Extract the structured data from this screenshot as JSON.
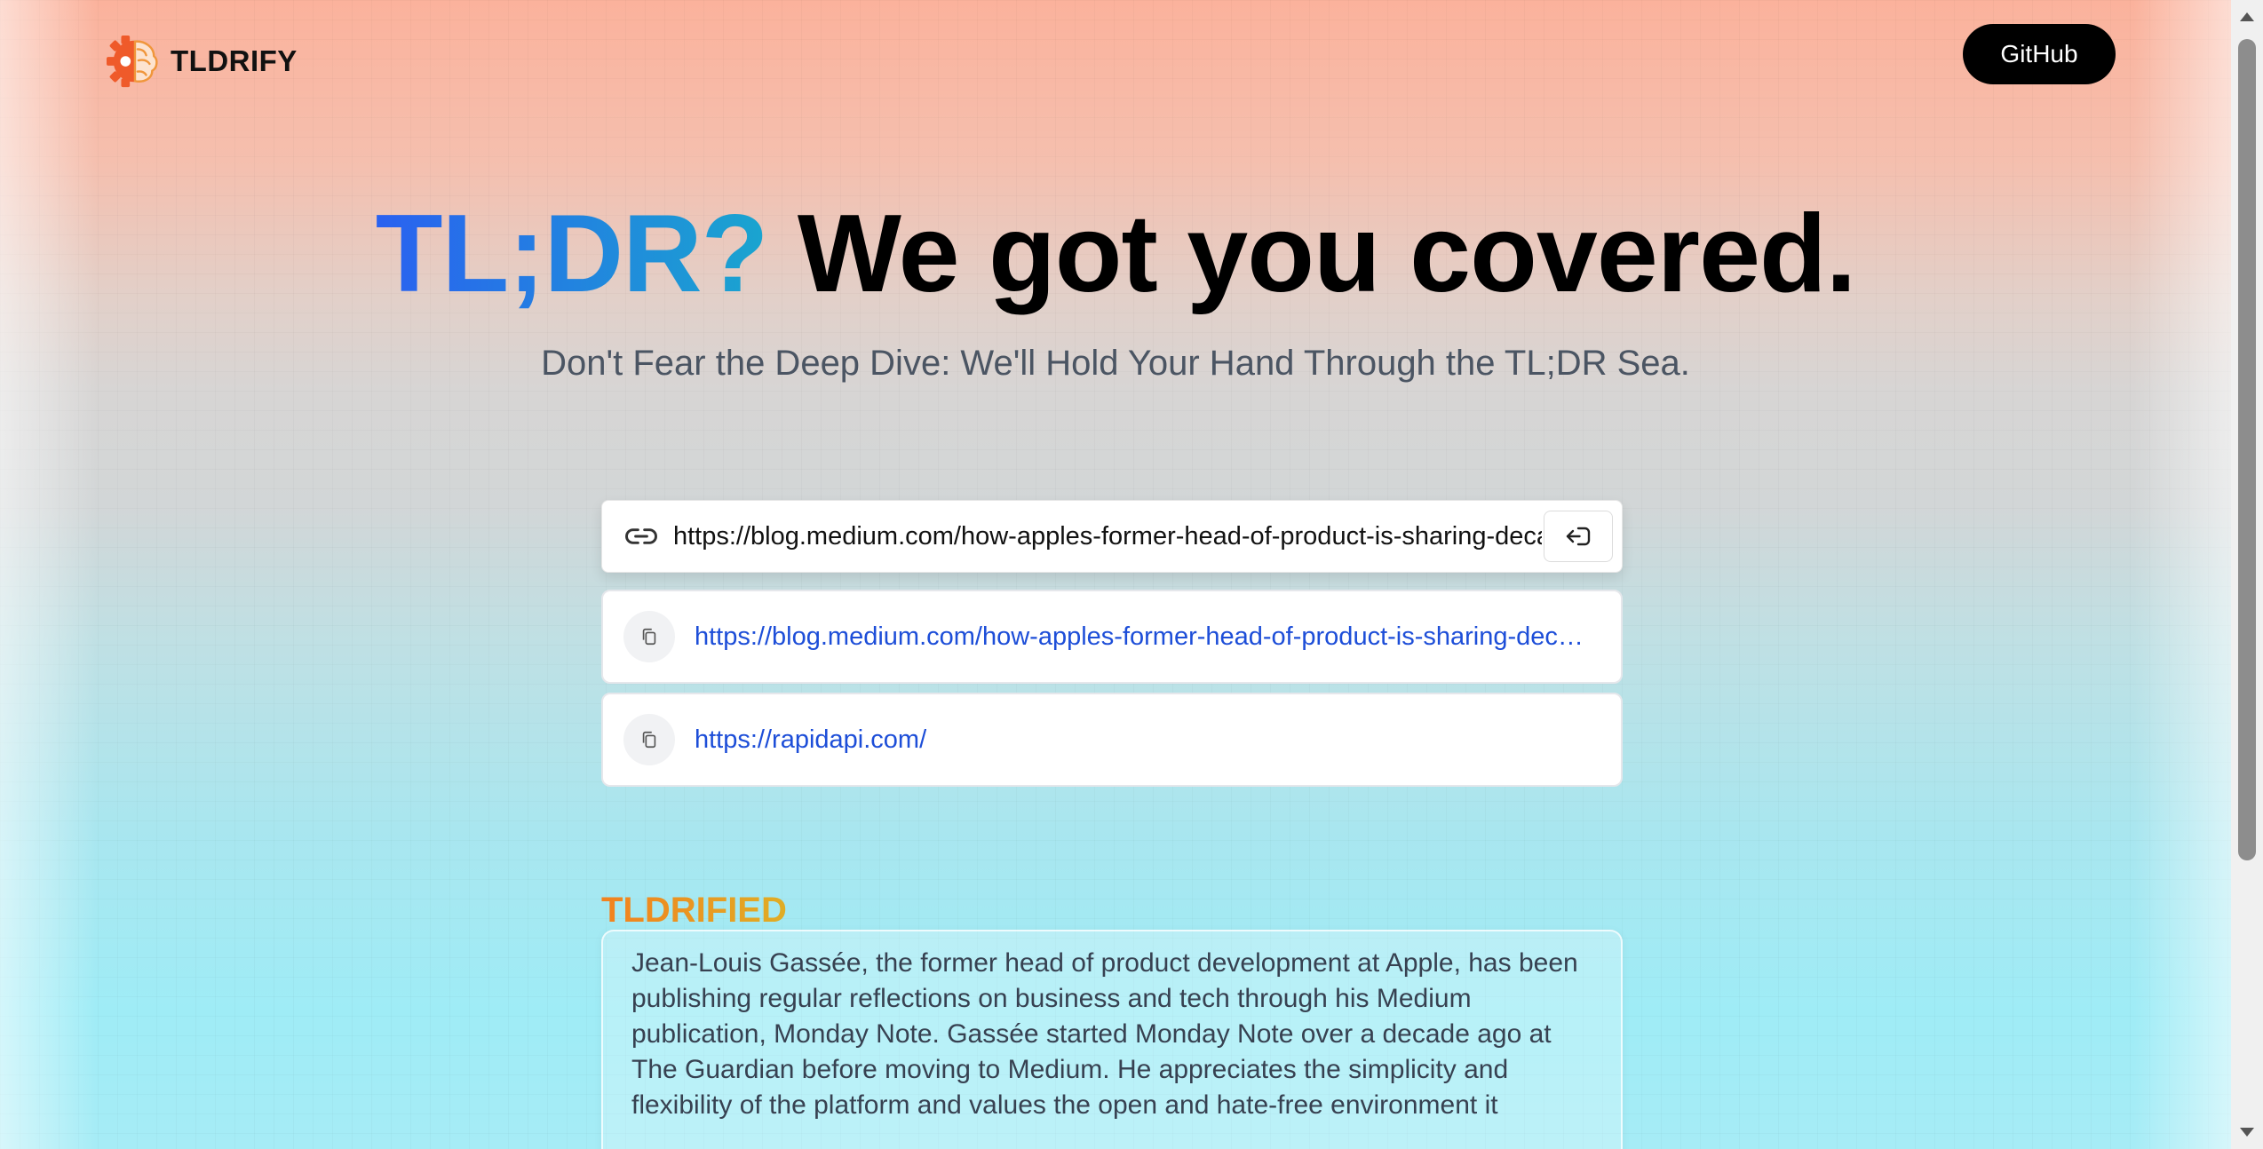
{
  "header": {
    "logo_text": "TLDRIFY",
    "github_label": "GitHub"
  },
  "hero": {
    "title_accent": "TL;DR?",
    "title_rest": "We got you covered.",
    "subtitle": "Don't Fear the Deep Dive: We'll Hold Your Hand Through the TL;DR Sea."
  },
  "search": {
    "value": "https://blog.medium.com/how-apples-former-head-of-product-is-sharing-decade"
  },
  "history": [
    {
      "url": "https://blog.medium.com/how-apples-former-head-of-product-is-sharing-decades-of-wisdom"
    },
    {
      "url": "https://rapidapi.com/"
    }
  ],
  "result": {
    "title": "TLDRIFIED",
    "summary": "Jean-Louis Gassée, the former head of product development at Apple, has been publishing regular reflections on business and tech through his Medium publication, Monday Note. Gassée started Monday Note over a decade ago at The Guardian before moving to Medium. He appreciates the simplicity and flexibility of the platform and values the open and hate-free environment it"
  },
  "colors": {
    "accent_blue": "#2a61f0",
    "accent_teal": "#1aa5cf",
    "accent_orange": "#f2811f",
    "link_blue": "#1d4ed8"
  },
  "icons": {
    "logo": "brain-gear-icon",
    "url_field": "link-icon",
    "submit": "enter-icon",
    "history": "copy-icon"
  }
}
